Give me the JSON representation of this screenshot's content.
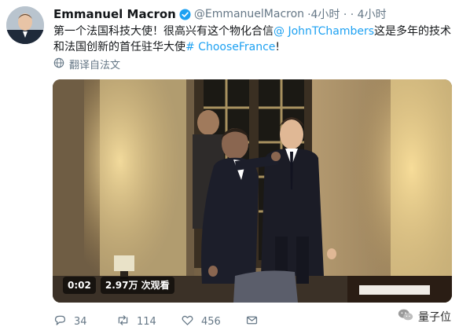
{
  "tweet": {
    "display_name": "Emmanuel Macron",
    "handle": "@EmmanuelMacron",
    "meta": "·4小时 · · 4小时",
    "text_line1_a": "第一个法国科技大使！很高兴有这个物化合信",
    "mention": "@ JohnTChambers",
    "text_line1_b": "这是多年的技术",
    "text_line2_a": "和法国创新的首任驻华大使",
    "hashtag": "# ChooseFrance",
    "text_line2_b": "!",
    "translate_label": "翻译自法文"
  },
  "video": {
    "duration": "0:02",
    "views": "2.97万 次观看"
  },
  "actions": {
    "replies": "34",
    "retweets": "114",
    "likes": "456"
  },
  "watermark": {
    "text": "量子位"
  },
  "icons": {
    "verified": "verified-badge-icon",
    "translate": "globe-icon",
    "reply": "reply-icon",
    "retweet": "retweet-icon",
    "like": "heart-icon",
    "message": "envelope-icon",
    "watermark": "wechat-icon"
  },
  "colors": {
    "link": "#1da1f2",
    "muted": "#657786",
    "text": "#14171a"
  }
}
